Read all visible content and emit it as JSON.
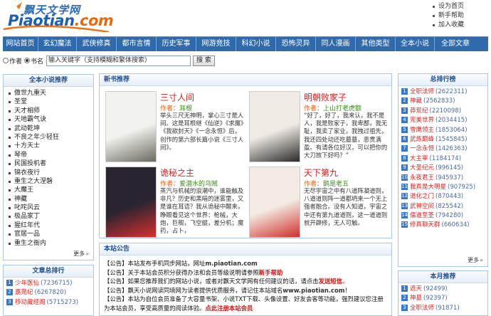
{
  "site": {
    "logo_cn": "飘天文学网",
    "logo_en_main": "Piaotian",
    "logo_en_suffix": ".com"
  },
  "toplinks": [
    "设为首页",
    "新手帮助",
    "加入收藏"
  ],
  "nav": [
    "网站首页",
    "玄幻魔法",
    "武侠修真",
    "都市言情",
    "历史军事",
    "网游竞技",
    "科幻小说",
    "恐怖灵异",
    "同人漫画",
    "其他类型",
    "全本小说",
    "全部文章"
  ],
  "search": {
    "radio_author": "作者",
    "radio_title": "书名",
    "input_value": "输入关键字（支持模糊和繁体搜索）",
    "button": "搜 索"
  },
  "left_finished": {
    "title": "全本小说推荐",
    "items": [
      "傲世九重天",
      "圣堂",
      "天才相师",
      "天地霸气诀",
      "武动乾坤",
      "不良之年少轻狂",
      "十方天士",
      "琴帝",
      "民国投机者",
      "锦衣夜行",
      "重生之大涅磐",
      "大魔王",
      "神藏",
      "叱咤风云",
      "极品家丁",
      "猩红年代",
      "官居一品",
      "重生之衙内"
    ],
    "more": "更多"
  },
  "left_article_rank": {
    "title": "文章总排行",
    "items": [
      {
        "num": "1",
        "name": "少年医仙",
        "count": "(7236715)"
      },
      {
        "num": "2",
        "name": "嘉苑纪",
        "count": "(6267820)"
      },
      {
        "num": "3",
        "name": "移动藏经阁",
        "count": "(5715273)"
      }
    ]
  },
  "new_books": {
    "title": "新书推荐",
    "books": [
      {
        "title": "三寸人间",
        "author_label": "作者：",
        "author": "耳根",
        "desc": "举头三尺无神明，掌心三寸是人间。这是耳根继《仙逆》《求魔》《我欲封天》《一念永恒》后，创作的第六部长篇小说《三寸人间》。"
      },
      {
        "title": "明朝败家子",
        "author_label": "作者：",
        "author": "上山打老虎额",
        "desc": "“好了，好了，我来认，我不是人，我是败家子，我卑鄙，我无耻，我卖了家业，我拽过祖先，我还四处动还吃墓墓，恶贯满盈。有请各位好汉，可以把你的大刀放下好吗？”"
      },
      {
        "title": "诡秘之主",
        "author_label": "作者：",
        "author": "爱潜水的乌贼",
        "desc": "蒸汽与机械的浪潮中，谁能触及非凡？历史和黑暗的迷雾里，又是谁在耳语？我从诡秘中醒来，睁眼看见这个世界：枪械，大炮，巨舰，飞空艇，差分机；魔药，占卜，"
      },
      {
        "title": "天下第九",
        "author_label": "作者：",
        "author": "鹅是老五",
        "desc": "无尽宇宙之中有八道阵凝道则，八道道则阵一道都坍来一个无上强者融合。没有人知道，宇宙之中还有第九道道则，这一道道则就开辟修，无人可触。"
      }
    ]
  },
  "notice": {
    "title": "本站公告",
    "items": [
      {
        "prefix": "【公告】",
        "text": "本站发布手机同步网站，网址",
        "hl": "m.piaotian.com",
        "suffix": ""
      },
      {
        "prefix": "【公告】",
        "text": "关于本站会员积分获得办法和会员等级说明请参照",
        "hl": "新手帮助",
        "suffix": ""
      },
      {
        "prefix": "【公告】",
        "text": "如果您推荐我们的网站小说，或者对飘天文学网有任何建议的话，请点击",
        "hl": "发送短信",
        "suffix": "。"
      },
      {
        "prefix": "【公告】",
        "text": "飘天小说网读同境网为读者提供优质服务，请记住本站域名",
        "hl": "www.piaotian.com",
        "suffix": "！"
      },
      {
        "prefix": "【公告】",
        "text": "本站为自位会员准备了大容量书架、小说TXT下载、头像设置、好友会客等功能，强烈建议您注册为本站会员，享受高质量的阅读体验。",
        "hl": "点此注册本站会员",
        "suffix": ""
      }
    ]
  },
  "right_recommend": {
    "title": "总排行榜",
    "items": [
      {
        "num": "1",
        "name": "全职法师",
        "count": "(2622311)"
      },
      {
        "num": "2",
        "name": "神藏",
        "count": "(2562833)"
      },
      {
        "num": "3",
        "name": "莽荒纪",
        "count": "(2210098)"
      },
      {
        "num": "4",
        "name": "完美世界",
        "count": "(2034415)"
      },
      {
        "num": "5",
        "name": "雪鹰领主",
        "count": "(1853064)"
      },
      {
        "num": "6",
        "name": "武炼巅峰",
        "count": "(1545845)"
      },
      {
        "num": "7",
        "name": "一念永恒",
        "count": "(1426363)"
      },
      {
        "num": "8",
        "name": "大主宰",
        "count": "(1184174)"
      },
      {
        "num": "9",
        "name": "大圣纪元",
        "count": "(996145)"
      },
      {
        "num": "10",
        "name": "永夜君王",
        "count": "(945937)"
      },
      {
        "num": "11",
        "name": "我真是大明星",
        "count": "(907925)"
      },
      {
        "num": "12",
        "name": "道化之门",
        "count": "(870443)"
      },
      {
        "num": "13",
        "name": "武神空间",
        "count": "(825542)"
      },
      {
        "num": "14",
        "name": "儒道至圣",
        "count": "(794280)"
      },
      {
        "num": "15",
        "name": "修真聊天群",
        "count": "(660634)"
      }
    ],
    "more": "更多"
  },
  "right_month": {
    "title": "本月推荐",
    "items": [
      {
        "num": "1",
        "name": "遮天",
        "count": "(92499)"
      },
      {
        "num": "2",
        "name": "神墓",
        "count": "(92397)"
      },
      {
        "num": "3",
        "name": "全职法师",
        "count": "(91871)"
      }
    ]
  },
  "colors": {
    "nav_bg": "#2f6bac",
    "accent_red": "#d02020",
    "border": "#a9c6e4"
  }
}
